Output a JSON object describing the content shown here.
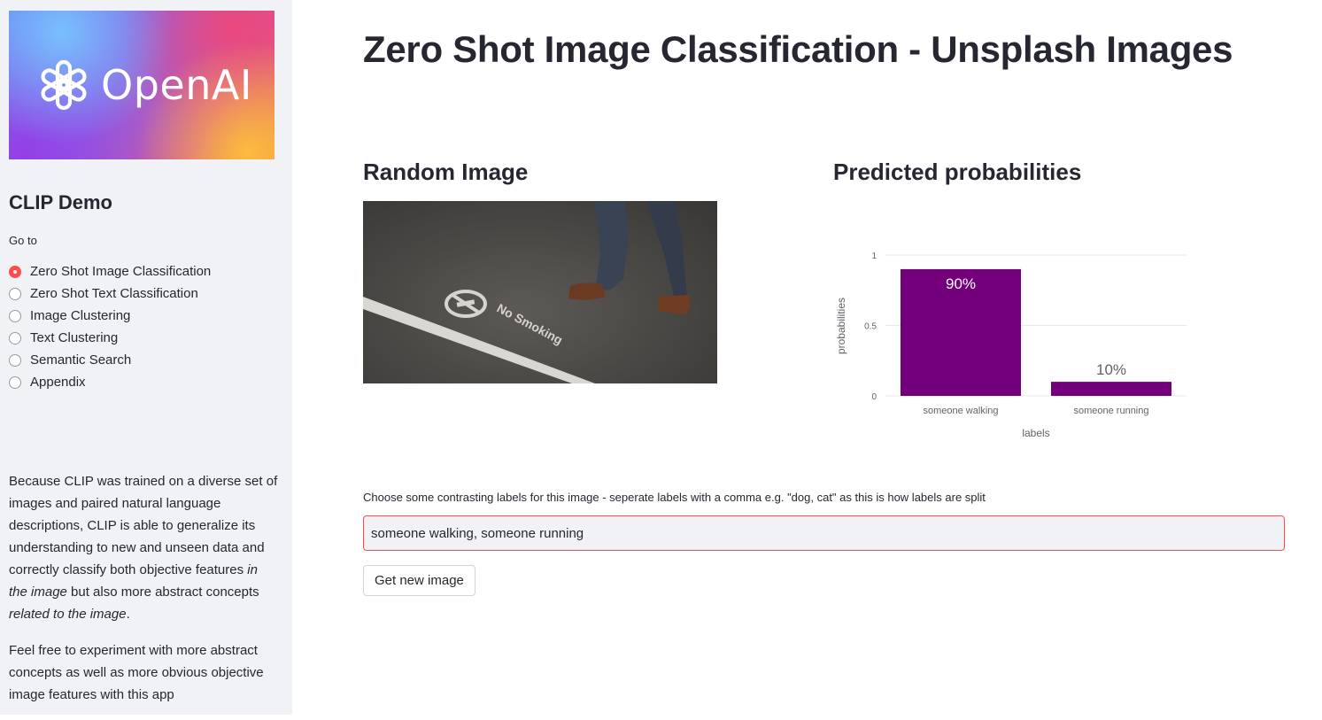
{
  "sidebar": {
    "logo_text": "OpenAI",
    "title": "CLIP Demo",
    "goto_label": "Go to",
    "nav_items": [
      {
        "label": "Zero Shot Image Classification",
        "selected": true
      },
      {
        "label": "Zero Shot Text Classification",
        "selected": false
      },
      {
        "label": "Image Clustering",
        "selected": false
      },
      {
        "label": "Text Clustering",
        "selected": false
      },
      {
        "label": "Semantic Search",
        "selected": false
      },
      {
        "label": "Appendix",
        "selected": false
      }
    ],
    "description": {
      "p1_text_1": "Because CLIP was trained on a diverse set of images and paired natural language descriptions, CLIP is able to generalize its understanding to new and unseen data and correctly classify both objective features ",
      "p1_em_1": "in the image",
      "p1_text_2": " but also more abstract concepts ",
      "p1_em_2": "related to the image",
      "p1_text_3": ".",
      "p2": "Feel free to experiment with more abstract concepts as well as more obvious objective image features with this app"
    }
  },
  "main": {
    "title": "Zero Shot Image Classification - Unsplash Images",
    "random_image_heading": "Random Image",
    "predicted_heading": "Predicted probabilities",
    "photo_sign_text": "No Smoking",
    "input_label": "Choose some contrasting labels for this image - seperate labels with a comma e.g. \"dog, cat\" as this is how labels are split",
    "input_value": "someone walking, someone running",
    "button_label": "Get new image"
  },
  "colors": {
    "accent": "#ff4b4b",
    "bar": "#73007a",
    "sidebar_bg": "#f0f2f6"
  },
  "chart_data": {
    "type": "bar",
    "categories": [
      "someone walking",
      "someone running"
    ],
    "values": [
      0.9,
      0.1
    ],
    "data_labels": [
      "90%",
      "10%"
    ],
    "xlabel": "labels",
    "ylabel": "probabilities",
    "ylim": [
      0,
      1
    ],
    "yticks": [
      "0",
      "0.5",
      "1"
    ],
    "grid": true
  }
}
